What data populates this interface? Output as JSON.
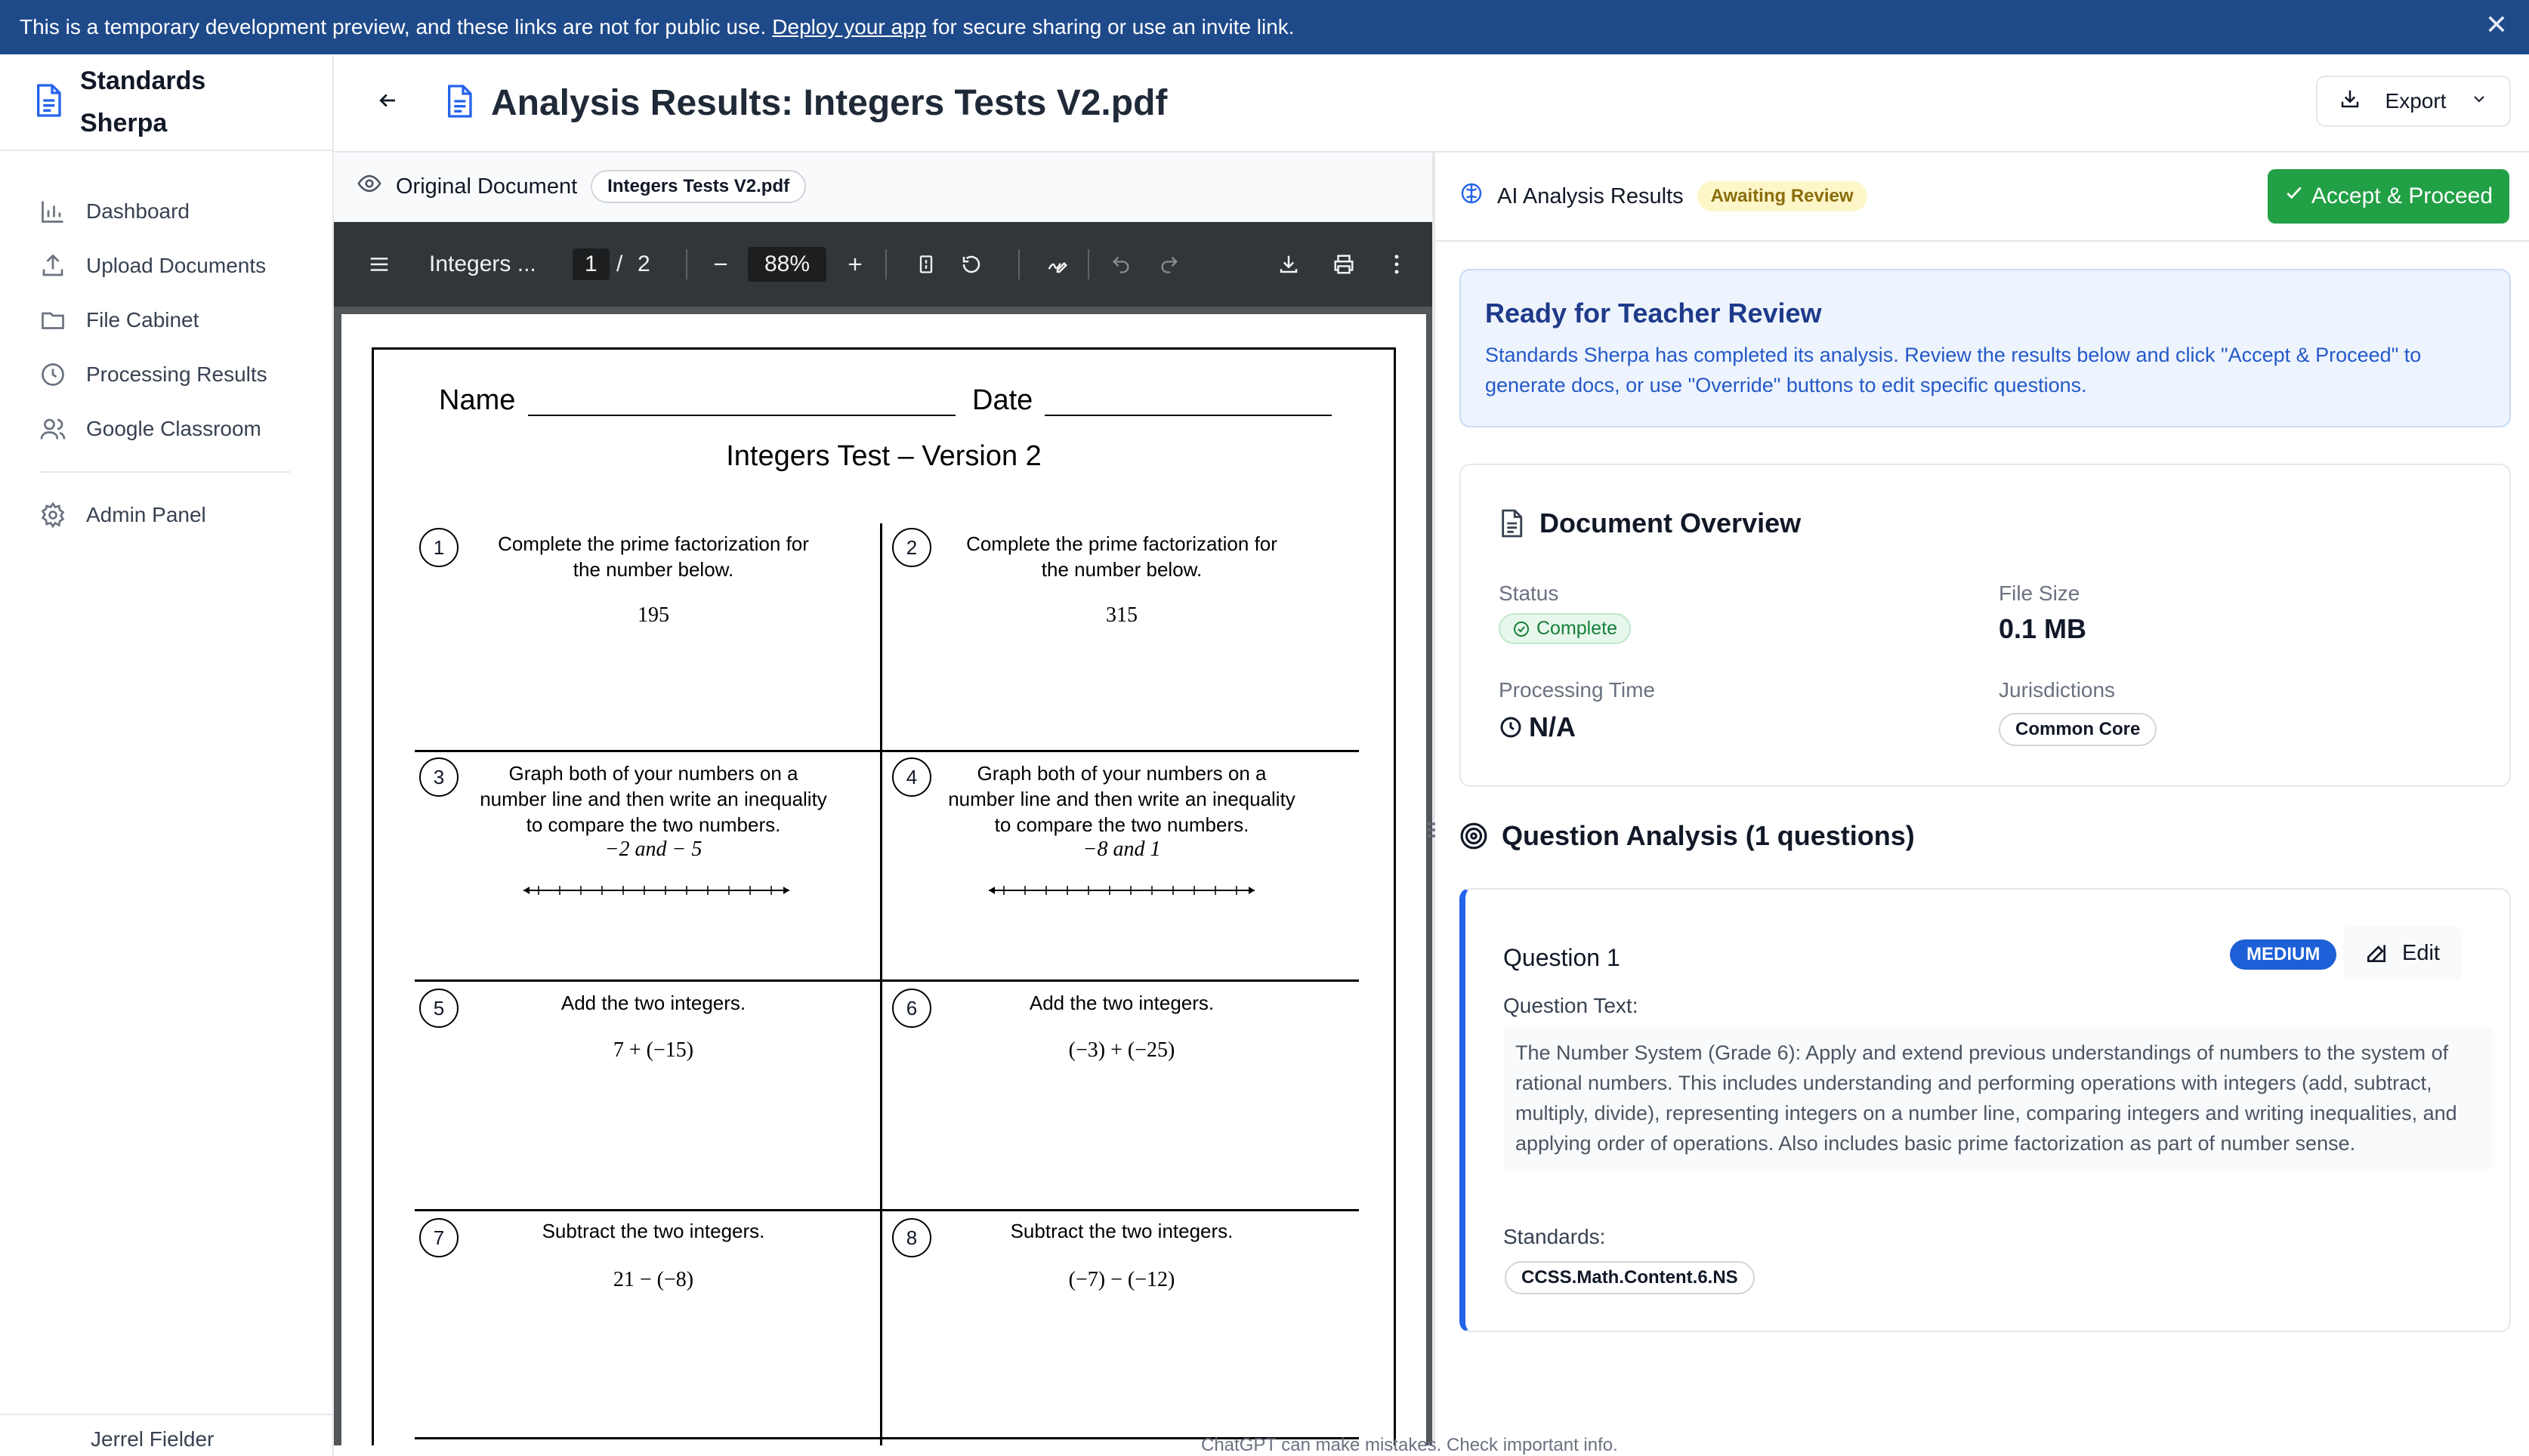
{
  "banner": {
    "text_before": "This is a temporary development preview, and these links are not for public use.",
    "link": "Deploy your app",
    "text_after": "for secure sharing or use an invite link.",
    "close": "✕"
  },
  "brand": {
    "name_line1": "Standards",
    "name_line2": "Sherpa"
  },
  "sidebar": {
    "items": [
      {
        "label": "Dashboard",
        "icon": "bar-chart-icon"
      },
      {
        "label": "Upload Documents",
        "icon": "upload-icon"
      },
      {
        "label": "File Cabinet",
        "icon": "folder-icon"
      },
      {
        "label": "Processing Results",
        "icon": "clock-icon"
      },
      {
        "label": "Google Classroom",
        "icon": "users-icon"
      }
    ],
    "admin": {
      "label": "Admin Panel",
      "icon": "gear-icon"
    },
    "user": "Jerrel Fielder"
  },
  "header": {
    "title": "Analysis Results: Integers Tests V2.pdf",
    "export_label": "Export"
  },
  "document": {
    "header_label": "Original Document",
    "file_badge": "Integers Tests V2.pdf",
    "viewer": {
      "doc_title": "Integers ...",
      "page_current": "1",
      "page_sep": "/",
      "page_total": "2",
      "zoom": "88%"
    },
    "pdf": {
      "name_label": "Name",
      "date_label": "Date",
      "test_title": "Integers Test – Version 2",
      "questions": [
        {
          "num": "1",
          "line1": "Complete the prime factorization for",
          "line2": "the number below.",
          "value": "195"
        },
        {
          "num": "2",
          "line1": "Complete the prime factorization for",
          "line2": "the number below.",
          "value": "315"
        },
        {
          "num": "3",
          "line1": "Graph both of your numbers on a",
          "line2": "number line and then write an inequality",
          "line3": "to compare the two numbers.",
          "value": "−2 and  − 5"
        },
        {
          "num": "4",
          "line1": "Graph both of your numbers on a",
          "line2": "number line and then write an inequality",
          "line3": "to compare the two numbers.",
          "value": "−8 and 1"
        },
        {
          "num": "5",
          "line1": "Add the two integers.",
          "value": "7 + (−15)"
        },
        {
          "num": "6",
          "line1": "Add the two integers.",
          "value": "(−3) + (−25)"
        },
        {
          "num": "7",
          "line1": "Subtract the two integers.",
          "value": "21 − (−8)"
        },
        {
          "num": "8",
          "line1": "Subtract the two integers.",
          "value": "(−7) − (−12)"
        }
      ]
    }
  },
  "analysis": {
    "header_label": "AI Analysis Results",
    "status_badge": "Awaiting Review",
    "accept_label": "Accept & Proceed",
    "review": {
      "title": "Ready for Teacher Review",
      "description": "Standards Sherpa has completed its analysis. Review the results below and click \"Accept & Proceed\" to generate docs, or use \"Override\" buttons to edit specific questions."
    },
    "overview": {
      "title": "Document Overview",
      "status_label": "Status",
      "status_value": "Complete",
      "file_size_label": "File Size",
      "file_size_value": "0.1 MB",
      "processing_time_label": "Processing Time",
      "processing_time_value": "N/A",
      "jurisdictions_label": "Jurisdictions",
      "jurisdictions_value": "Common Core"
    },
    "question_analysis_title": "Question Analysis (1 questions)",
    "question": {
      "title": "Question 1",
      "difficulty": "MEDIUM",
      "edit_label": "Edit",
      "text_label": "Question Text:",
      "text": "The Number System (Grade 6): Apply and extend previous understandings of numbers to the system of rational numbers. This includes understanding and performing operations with integers (add, subtract, multiply, divide), representing integers on a number line, comparing integers and writing inequalities, and applying order of operations. Also includes basic prime factorization as part of number sense.",
      "standards_label": "Standards:",
      "standard": "CCSS.Math.Content.6.NS"
    }
  },
  "footer_note": "ChatGPT can make mistakes. Check important info.",
  "colors": {
    "banner": "#1f4a8a",
    "accept": "#22a045",
    "accent": "#2563eb",
    "review_bg": "#eef4fd"
  }
}
